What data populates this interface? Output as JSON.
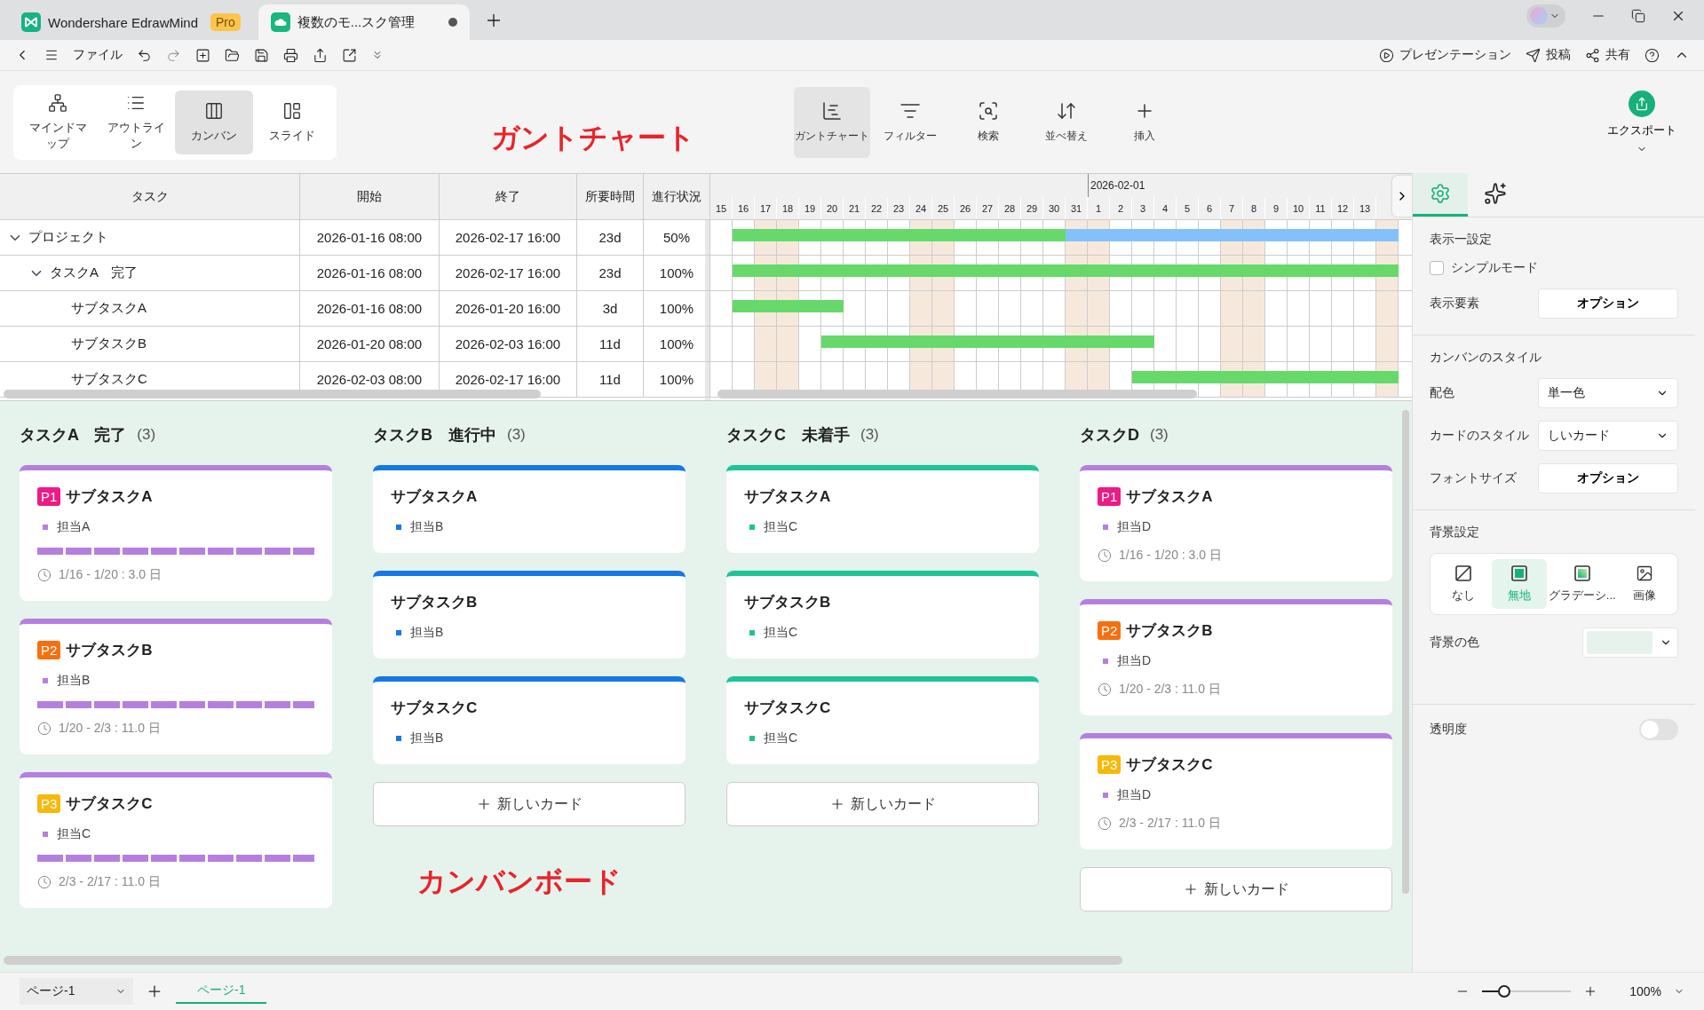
{
  "app_tabs": [
    {
      "kind": "home",
      "label": "Wondershare EdrawMind",
      "badge": "Pro",
      "selected": false
    },
    {
      "kind": "doc",
      "label": "複数のモ...スク管理",
      "selected": true
    }
  ],
  "quick_toolbar": {
    "menu": "ファイル"
  },
  "top_actions": [
    {
      "kind": "present",
      "label": "プレゼンテーション"
    },
    {
      "kind": "post",
      "label": "投稿"
    },
    {
      "kind": "share",
      "label": "共有"
    }
  ],
  "view_modes": [
    {
      "kind": "mindmap",
      "label": "マインドマップ",
      "selected": false
    },
    {
      "kind": "outline",
      "label": "アウトライン",
      "selected": false
    },
    {
      "kind": "kanban",
      "label": "カンバン",
      "selected": true
    },
    {
      "kind": "slide",
      "label": "スライド",
      "selected": false
    }
  ],
  "tools": [
    {
      "kind": "gantt",
      "label": "ガントチャート",
      "selected": true
    },
    {
      "kind": "filter",
      "label": "フィルター",
      "selected": false
    },
    {
      "kind": "search",
      "label": "検索",
      "selected": false
    },
    {
      "kind": "sort",
      "label": "並べ替え",
      "selected": false
    },
    {
      "kind": "insert",
      "label": "挿入",
      "selected": false
    }
  ],
  "export": {
    "label": "エクスポート"
  },
  "annotations": [
    "ガントチャート",
    "カンバンボード"
  ],
  "gantt": {
    "columns": [
      "タスク",
      "開始",
      "終了",
      "所要時間",
      "進行状況"
    ],
    "month_label": "2026-02-01",
    "days": [
      {
        "label": "15",
        "weekend": false
      },
      {
        "label": "16",
        "weekend": false
      },
      {
        "label": "17",
        "weekend": true
      },
      {
        "label": "18",
        "weekend": true
      },
      {
        "label": "19",
        "weekend": false
      },
      {
        "label": "20",
        "weekend": false
      },
      {
        "label": "21",
        "weekend": false
      },
      {
        "label": "22",
        "weekend": false
      },
      {
        "label": "23",
        "weekend": false
      },
      {
        "label": "24",
        "weekend": true
      },
      {
        "label": "25",
        "weekend": true
      },
      {
        "label": "26",
        "weekend": false
      },
      {
        "label": "27",
        "weekend": false
      },
      {
        "label": "28",
        "weekend": false
      },
      {
        "label": "29",
        "weekend": false
      },
      {
        "label": "30",
        "weekend": false
      },
      {
        "label": "31",
        "weekend": true
      },
      {
        "label": "1",
        "weekend": true
      },
      {
        "label": "2",
        "weekend": false
      },
      {
        "label": "3",
        "weekend": false
      },
      {
        "label": "4",
        "weekend": false
      },
      {
        "label": "5",
        "weekend": false
      },
      {
        "label": "6",
        "weekend": false
      },
      {
        "label": "7",
        "weekend": true
      },
      {
        "label": "8",
        "weekend": true
      },
      {
        "label": "9",
        "weekend": false
      },
      {
        "label": "10",
        "weekend": false
      },
      {
        "label": "11",
        "weekend": false
      },
      {
        "label": "12",
        "weekend": false
      },
      {
        "label": "13",
        "weekend": false
      }
    ],
    "tasks": [
      {
        "task": "プロジェクト",
        "start": "2026-01-16 08:00",
        "end": "2026-02-17 16:00",
        "duration": "23d",
        "progress": "50%",
        "level": 0.5,
        "expanded": true,
        "children": [
          {
            "task": "タスクA　完了",
            "start": "2026-01-16 08:00",
            "end": "2026-02-17 16:00",
            "duration": "23d",
            "progress": "100%",
            "level": 1,
            "expanded": true,
            "children": [
              {
                "task": "サブタスクA",
                "start": "2026-01-16 08:00",
                "end": "2026-01-20 16:00",
                "duration": "3d",
                "progress": "100%",
                "level": 1
              },
              {
                "task": "サブタスクB",
                "start": "2026-01-20 08:00",
                "end": "2026-02-03 16:00",
                "duration": "11d",
                "progress": "100%",
                "level": 1
              },
              {
                "task": "サブタスクC",
                "start": "2026-02-03 08:00",
                "end": "2026-02-17 16:00",
                "duration": "11d",
                "progress": "100%",
                "level": 1
              }
            ]
          }
        ]
      }
    ]
  },
  "kanban": {
    "columns": [
      {
        "title": "タスクA　完了",
        "count": "(3)",
        "color": "#b57fdf",
        "cards": [
          {
            "title": "サブタスクA",
            "badge": {
              "label": "P1",
              "color": "#ee1a85"
            },
            "assignee": "担当A",
            "level": 1,
            "dates": "1/16 - 1/20 : 3.0 日"
          },
          {
            "title": "サブタスクB",
            "badge": {
              "label": "P2",
              "color": "#f6700f"
            },
            "assignee": "担当B",
            "level": 1,
            "dates": "1/20 - 2/3 : 11.0 日"
          },
          {
            "title": "サブタスクC",
            "badge": {
              "label": "P3",
              "color": "#f6b90b"
            },
            "assignee": "担当C",
            "level": 1,
            "dates": "2/3 - 2/17 : 11.0 日"
          }
        ]
      },
      {
        "title": "タスクB　進行中",
        "count": "(3)",
        "color": "#1677e6",
        "cards": [
          {
            "title": "サブタスクA",
            "assignee": "担当B"
          },
          {
            "title": "サブタスクB",
            "assignee": "担当B"
          },
          {
            "title": "サブタスクC",
            "assignee": "担当B"
          }
        ],
        "add_label": "新しいカード"
      },
      {
        "title": "タスクC　未着手",
        "count": "(3)",
        "color": "#1dc497",
        "cards": [
          {
            "title": "サブタスクA",
            "assignee": "担当C"
          },
          {
            "title": "サブタスクB",
            "assignee": "担当C"
          },
          {
            "title": "サブタスクC",
            "assignee": "担当C"
          }
        ],
        "add_label": "新しいカード"
      },
      {
        "title": "タスクD",
        "count": "(3)",
        "color": "#b57fdf",
        "cards": [
          {
            "title": "サブタスクA",
            "badge": {
              "label": "P1",
              "color": "#ee1a85"
            },
            "assignee": "担当D",
            "dates": "1/16 - 1/20 : 3.0 日"
          },
          {
            "title": "サブタスクB",
            "badge": {
              "label": "P2",
              "color": "#f6700f"
            },
            "assignee": "担当D",
            "dates": "1/20 - 2/3 : 11.0 日"
          },
          {
            "title": "サブタスクC",
            "badge": {
              "label": "P3",
              "color": "#f6b90b"
            },
            "assignee": "担当D",
            "dates": "2/3 - 2/17 : 11.0 日"
          }
        ],
        "add_label": "新しいカード"
      }
    ]
  },
  "panel": {
    "tabs": [
      {
        "kind": "settings",
        "selected": true
      },
      {
        "kind": "ai",
        "selected": false
      }
    ],
    "display_heading": "表示一設定",
    "simple_mode": {
      "label": "シンプルモード",
      "checked": false
    },
    "display_elements": {
      "label": "表示要素",
      "button": "オプション"
    },
    "style_heading": "カンバンのスタイル",
    "color_scheme": {
      "label": "配色",
      "value": "単一色"
    },
    "card_style": {
      "label": "カードのスタイル",
      "value": "しいカード"
    },
    "font_size": {
      "label": "フォントサイズ",
      "button": "オプション"
    },
    "background_heading": "背景設定",
    "background_options": [
      {
        "kind": "none",
        "label": "なし",
        "selected": false
      },
      {
        "kind": "solid",
        "label": "無地",
        "selected": true
      },
      {
        "kind": "gradient",
        "label": "グラデーシ...",
        "selected": false
      },
      {
        "kind": "image",
        "label": "画像",
        "selected": false
      }
    ],
    "background_color": {
      "label": "背景の色",
      "color": "#e6f3ec"
    },
    "transparency": {
      "label": "透明度",
      "on": false
    }
  },
  "status_bar": {
    "page_select": "ページ-1",
    "pages": [
      {
        "label": "ページ-1",
        "selected": true
      }
    ],
    "zoom": {
      "level": 0.25,
      "value": "100%"
    }
  }
}
